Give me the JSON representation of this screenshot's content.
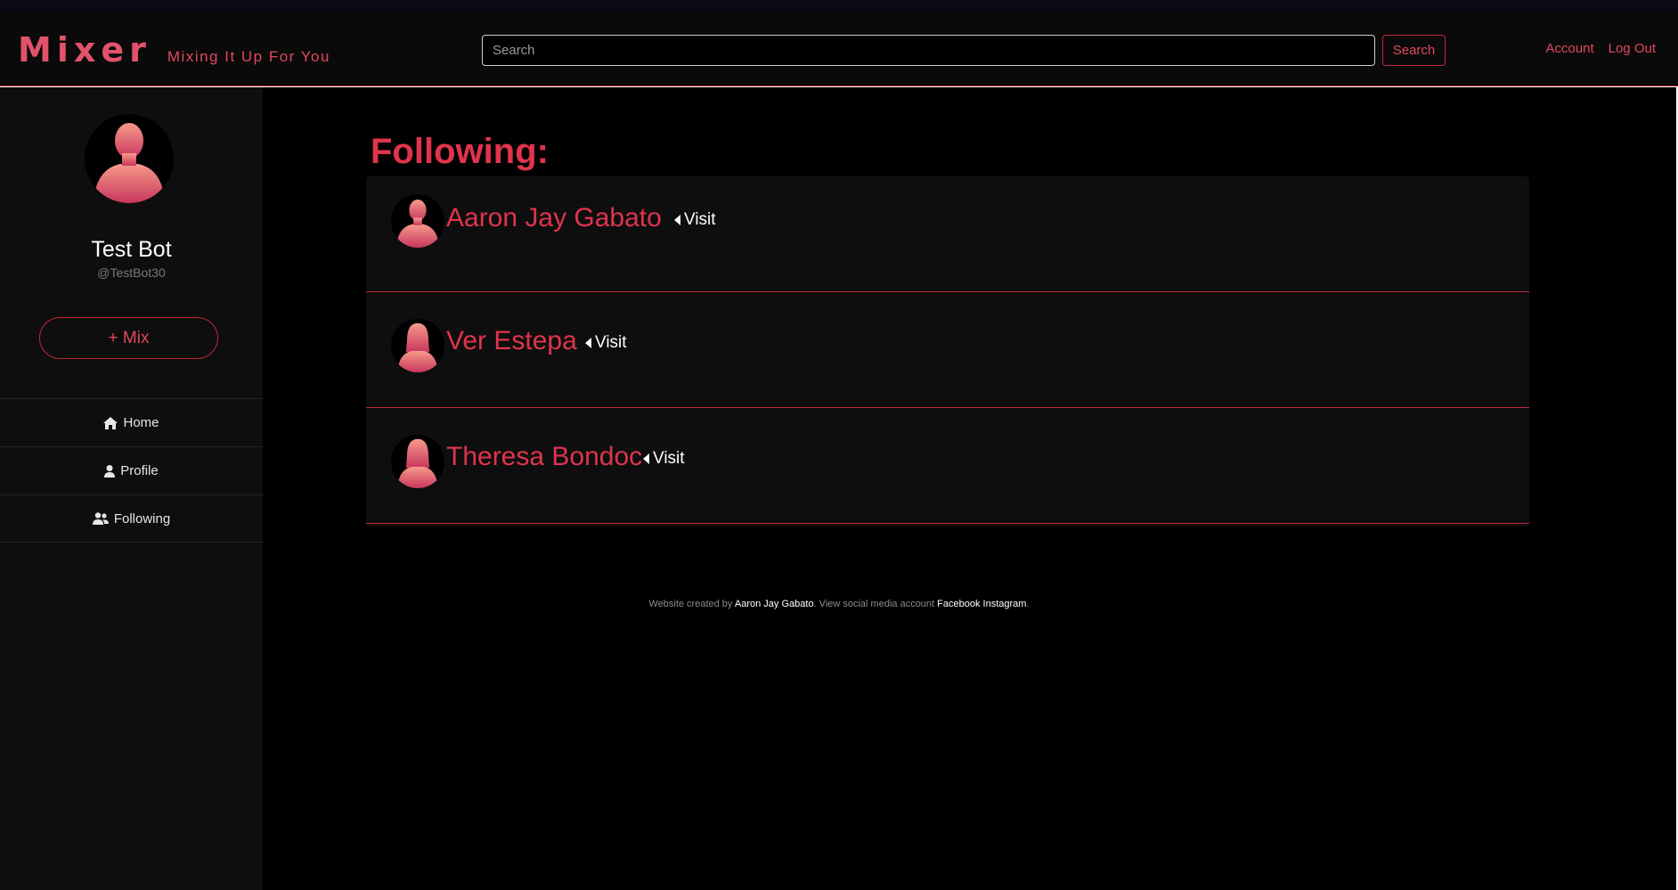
{
  "navbar": {
    "brand": "Mixer",
    "tagline": "Mixing It Up For You",
    "search_placeholder": "Search",
    "search_button": "Search",
    "links": [
      "Account",
      "Log Out"
    ]
  },
  "sidebar": {
    "name": "Test Bot",
    "handle": "@TestBot30",
    "mix_button": "+ Mix",
    "nav": [
      {
        "label": "Home",
        "icon": "home-icon"
      },
      {
        "label": "Profile",
        "icon": "user-icon"
      },
      {
        "label": "Following",
        "icon": "users-icon"
      }
    ]
  },
  "main": {
    "heading": "Following:",
    "following": [
      {
        "name": "Aaron Jay Gabato",
        "visit": "Visit",
        "avatar": "male-avatar"
      },
      {
        "name": "Ver Estepa",
        "visit": "Visit",
        "avatar": "female-avatar"
      },
      {
        "name": "Theresa Bondoc",
        "visit": "Visit",
        "avatar": "female-avatar"
      }
    ]
  },
  "footer": {
    "prefix": "Website created by",
    "author": "Aaron Jay Gabato",
    "middle": ". View social media account",
    "facebook": "Facebook",
    "instagram": "Instagram",
    "suffix": "."
  },
  "colors": {
    "accent": "#e0344c",
    "background": "#000000",
    "panel": "#0e0e0e"
  }
}
